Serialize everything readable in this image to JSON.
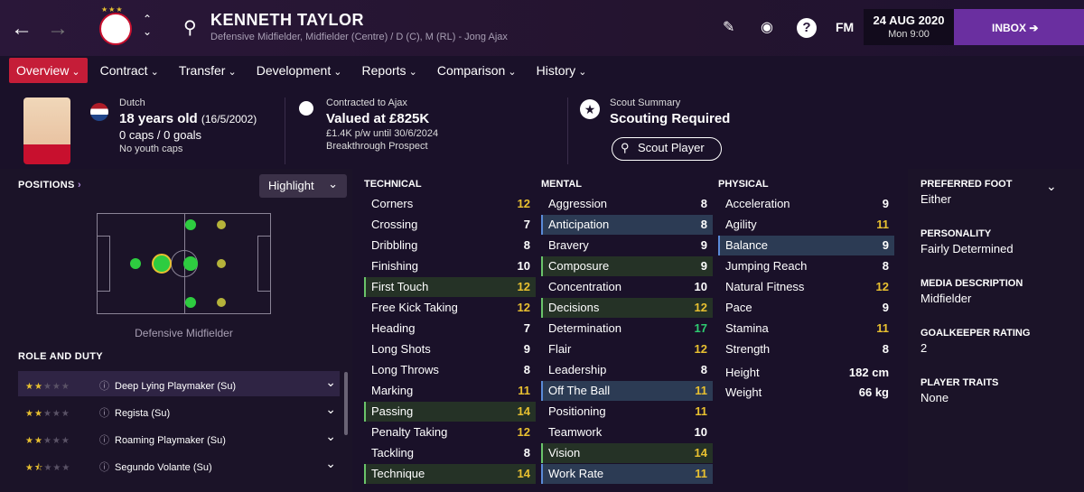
{
  "header": {
    "player_name": "KENNETH TAYLOR",
    "positions_line": "Defensive Midfielder, Midfielder (Centre) / D (C), M (RL) - Jong Ajax",
    "date": "24 AUG 2020",
    "time": "Mon 9:00",
    "fm_label": "FM",
    "inbox_label": "INBOX"
  },
  "tabs": [
    {
      "label": "Overview"
    },
    {
      "label": "Contract"
    },
    {
      "label": "Transfer"
    },
    {
      "label": "Development"
    },
    {
      "label": "Reports"
    },
    {
      "label": "Comparison"
    },
    {
      "label": "History"
    }
  ],
  "profile": {
    "nationality": "Dutch",
    "age_line": "18 years old",
    "dob": "(16/5/2002)",
    "caps": "0 caps / 0 goals",
    "youth_caps": "No youth caps"
  },
  "contract": {
    "label": "Contracted to Ajax",
    "value": "Valued at £825K",
    "wage": "£1.4K p/w until 30/6/2024",
    "status": "Breakthrough Prospect"
  },
  "scout": {
    "label": "Scout Summary",
    "status": "Scouting Required",
    "button": "Scout Player"
  },
  "positions": {
    "title": "POSITIONS",
    "highlight_label": "Highlight",
    "position_name": "Defensive Midfielder",
    "role_title": "ROLE AND DUTY",
    "roles": [
      {
        "name": "Deep Lying Playmaker (Su)",
        "stars": 2
      },
      {
        "name": "Regista (Su)",
        "stars": 2
      },
      {
        "name": "Roaming Playmaker (Su)",
        "stars": 2
      },
      {
        "name": "Segundo Volante (Su)",
        "stars": 1.5
      }
    ]
  },
  "technical": {
    "title": "TECHNICAL",
    "items": [
      {
        "name": "Corners",
        "value": "12"
      },
      {
        "name": "Crossing",
        "value": "7"
      },
      {
        "name": "Dribbling",
        "value": "8"
      },
      {
        "name": "Finishing",
        "value": "10"
      },
      {
        "name": "First Touch",
        "value": "12"
      },
      {
        "name": "Free Kick Taking",
        "value": "12"
      },
      {
        "name": "Heading",
        "value": "7"
      },
      {
        "name": "Long Shots",
        "value": "9"
      },
      {
        "name": "Long Throws",
        "value": "8"
      },
      {
        "name": "Marking",
        "value": "11"
      },
      {
        "name": "Passing",
        "value": "14"
      },
      {
        "name": "Penalty Taking",
        "value": "12"
      },
      {
        "name": "Tackling",
        "value": "8"
      },
      {
        "name": "Technique",
        "value": "14"
      }
    ]
  },
  "mental": {
    "title": "MENTAL",
    "items": [
      {
        "name": "Aggression",
        "value": "8"
      },
      {
        "name": "Anticipation",
        "value": "8"
      },
      {
        "name": "Bravery",
        "value": "9"
      },
      {
        "name": "Composure",
        "value": "9"
      },
      {
        "name": "Concentration",
        "value": "10"
      },
      {
        "name": "Decisions",
        "value": "12"
      },
      {
        "name": "Determination",
        "value": "17"
      },
      {
        "name": "Flair",
        "value": "12"
      },
      {
        "name": "Leadership",
        "value": "8"
      },
      {
        "name": "Off The Ball",
        "value": "11"
      },
      {
        "name": "Positioning",
        "value": "11"
      },
      {
        "name": "Teamwork",
        "value": "10"
      },
      {
        "name": "Vision",
        "value": "14"
      },
      {
        "name": "Work Rate",
        "value": "11"
      }
    ]
  },
  "physical": {
    "title": "PHYSICAL",
    "items": [
      {
        "name": "Acceleration",
        "value": "9"
      },
      {
        "name": "Agility",
        "value": "11"
      },
      {
        "name": "Balance",
        "value": "9"
      },
      {
        "name": "Jumping Reach",
        "value": "8"
      },
      {
        "name": "Natural Fitness",
        "value": "12"
      },
      {
        "name": "Pace",
        "value": "9"
      },
      {
        "name": "Stamina",
        "value": "11"
      },
      {
        "name": "Strength",
        "value": "8"
      }
    ],
    "height_label": "Height",
    "height": "182 cm",
    "weight_label": "Weight",
    "weight": "66 kg"
  },
  "details": [
    {
      "label": "PREFERRED FOOT",
      "value": "Either"
    },
    {
      "label": "PERSONALITY",
      "value": "Fairly Determined"
    },
    {
      "label": "MEDIA DESCRIPTION",
      "value": "Midfielder"
    },
    {
      "label": "GOALKEEPER RATING",
      "value": "2"
    },
    {
      "label": "PLAYER TRAITS",
      "value": "None"
    }
  ],
  "colors": {
    "accent": "#c51d38",
    "inbox": "#6a2fa0",
    "star": "#e8c030",
    "good": "#e8c030",
    "great": "#2ecc71",
    "normal": "#ffffff"
  }
}
